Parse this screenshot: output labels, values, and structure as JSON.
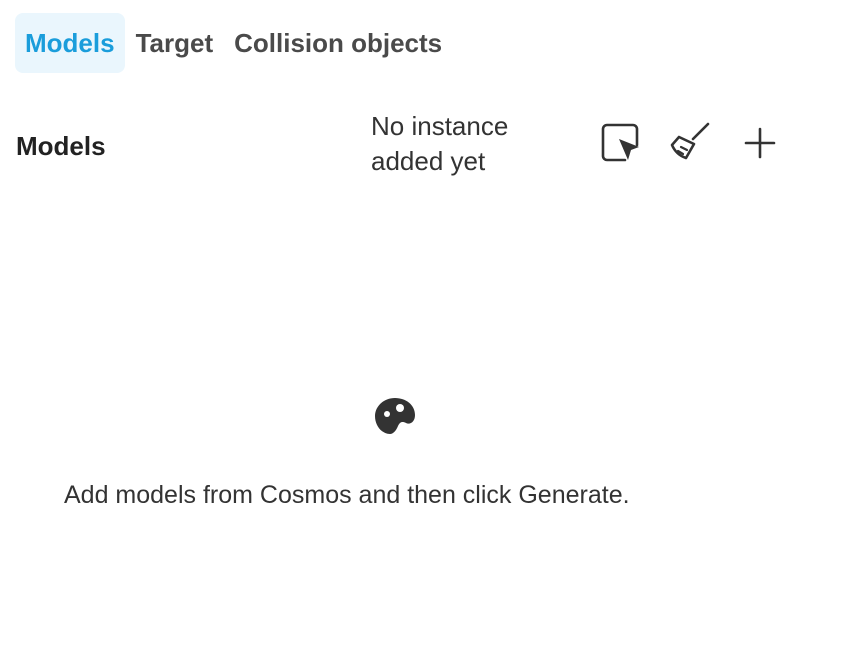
{
  "tabs": [
    {
      "label": "Models",
      "active": true
    },
    {
      "label": "Target",
      "active": false
    },
    {
      "label": "Collision objects",
      "active": false
    }
  ],
  "section": {
    "title": "Models",
    "status_line1": "No instance",
    "status_line2": "added yet"
  },
  "toolbar": {
    "icons": [
      "select-cursor-icon",
      "broom-icon",
      "plus-icon"
    ]
  },
  "empty_state": {
    "icon": "palette-icon",
    "message": "Add models from Cosmos and then click Generate."
  },
  "colors": {
    "accent": "#1a9ddb",
    "accent_bg": "#eaf6fd",
    "text": "#333333"
  }
}
